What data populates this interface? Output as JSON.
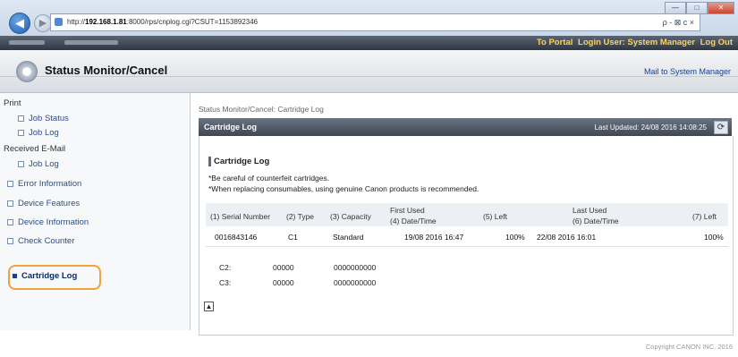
{
  "browser": {
    "url_prefix": "http://",
    "url_host": "192.168.1.81",
    "url_rest": ":8000/rps/cnplog.cgi?CSUT=1153892346",
    "addr_tools": "ρ - ⊠ c ×",
    "window_controls": [
      "—",
      "□",
      "✕"
    ]
  },
  "topbar": {
    "to_portal": "To Portal",
    "login_user": "Login User: System Manager",
    "logout": "Log Out"
  },
  "header": {
    "title": "Status Monitor/Cancel",
    "mail_link": "Mail to System Manager"
  },
  "sidebar": {
    "print": "Print",
    "job_status": "Job Status",
    "job_log": "Job Log",
    "received_email": "Received E-Mail",
    "job_log_2": "Job Log",
    "error_information": "Error Information",
    "device_features": "Device Features",
    "device_information": "Device Information",
    "check_counter": "Check Counter",
    "cartridge_log": "Cartridge Log"
  },
  "content": {
    "breadcrumb": "Status Monitor/Cancel: Cartridge Log",
    "bar_title": "Cartridge Log",
    "last_updated": "Last Updated: 24/08 2016 14:08:25",
    "refresh_icon": "refresh-icon",
    "section_title": "Cartridge Log",
    "note1": "*Be careful of counterfeit cartridges.",
    "note2": "*When replacing consumables, using genuine Canon products is recommended.",
    "headers": {
      "serial": "(1) Serial Number",
      "type": "(2) Type",
      "capacity": "(3) Capacity",
      "first_used": "First Used",
      "first_datetime": "(4) Date/Time",
      "left1": "(5) Left",
      "last_used": "Last Used",
      "last_datetime": "(6) Date/Time",
      "left2": "(7) Left"
    },
    "row": {
      "serial": "0016843146",
      "type": "C1",
      "capacity": "Standard",
      "first_datetime": "19/08 2016 16:47",
      "left1": "100%",
      "last_datetime": "22/08 2016 16:01",
      "left2": "100%"
    },
    "counters": [
      {
        "label": "C2:",
        "a": "00000",
        "b": "0000000000"
      },
      {
        "label": "C3:",
        "a": "00000",
        "b": "0000000000"
      }
    ],
    "page_top_icon": "▲"
  },
  "footer": {
    "copyright": "Copyright CANON INC. 2016"
  }
}
